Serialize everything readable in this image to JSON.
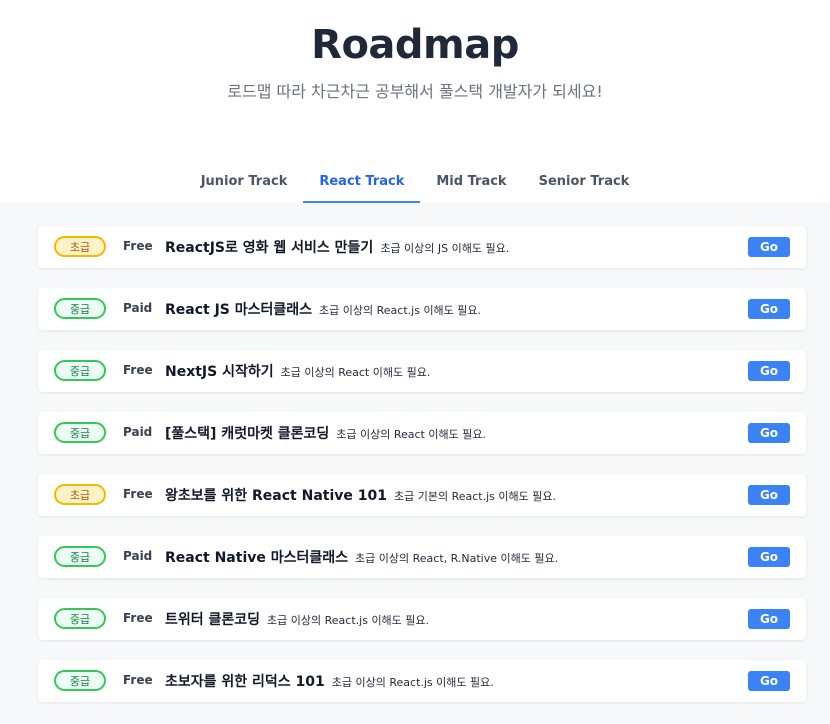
{
  "header": {
    "title": "Roadmap",
    "subtitle": "로드맵 따라 차근차근 공부해서 풀스택 개발자가 되세요!"
  },
  "tabs": [
    {
      "label": "Junior Track",
      "active": false
    },
    {
      "label": "React Track",
      "active": true
    },
    {
      "label": "Mid Track",
      "active": false
    },
    {
      "label": "Senior Track",
      "active": false
    }
  ],
  "colors": {
    "accent": "#3b82f6",
    "beginner_badge": "#f5b800",
    "intermediate_badge": "#34c759",
    "list_background": "#f7f8fa"
  },
  "courses": [
    {
      "level": "초급",
      "level_type": "beginner",
      "price": "Free",
      "title": "ReactJS로 영화 웹 서비스 만들기",
      "requirement": "초급 이상의 JS 이해도 필요.",
      "button": "Go"
    },
    {
      "level": "중급",
      "level_type": "intermediate",
      "price": "Paid",
      "title": "React JS 마스터클래스",
      "requirement": "초급 이상의 React.js 이해도 필요.",
      "button": "Go"
    },
    {
      "level": "중급",
      "level_type": "intermediate",
      "price": "Free",
      "title": "NextJS 시작하기",
      "requirement": "초급 이상의 React 이해도 필요.",
      "button": "Go"
    },
    {
      "level": "중급",
      "level_type": "intermediate",
      "price": "Paid",
      "title": "[풀스택] 캐럿마켓 클론코딩",
      "requirement": "초급 이상의 React 이해도 필요.",
      "button": "Go"
    },
    {
      "level": "초급",
      "level_type": "beginner",
      "price": "Free",
      "title": "왕초보를 위한 React Native 101",
      "requirement": "초급 기본의 React.js 이해도 필요.",
      "button": "Go"
    },
    {
      "level": "중급",
      "level_type": "intermediate",
      "price": "Paid",
      "title": "React Native 마스터클래스",
      "requirement": "초급 이상의 React, R.Native 이해도 필요.",
      "button": "Go"
    },
    {
      "level": "중급",
      "level_type": "intermediate",
      "price": "Free",
      "title": "트위터 클론코딩",
      "requirement": "초급 이상의 React.js 이해도 필요.",
      "button": "Go"
    },
    {
      "level": "중급",
      "level_type": "intermediate",
      "price": "Free",
      "title": "초보자를 위한 리덕스 101",
      "requirement": "초급 이상의 React.js 이해도 필요.",
      "button": "Go"
    }
  ]
}
